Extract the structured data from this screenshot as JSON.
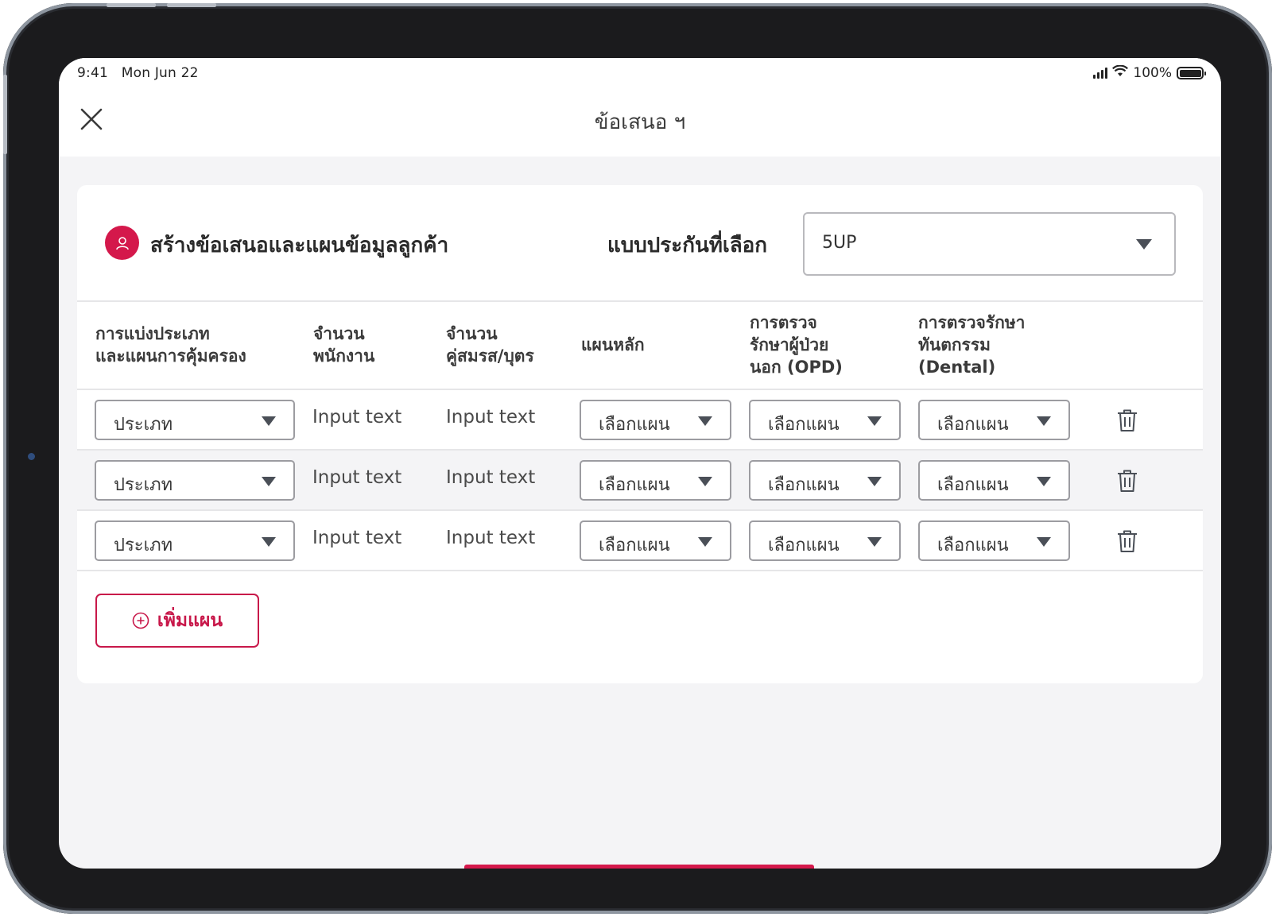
{
  "status_bar": {
    "time": "9:41",
    "date": "Mon Jun 22",
    "battery": "100%"
  },
  "nav": {
    "title": "ข้อเสนอ ฯ"
  },
  "card": {
    "title": "สร้างข้อเสนอและแผนข้อมูลลูกค้า",
    "insurance_label": "แบบประกันที่เลือก",
    "insurance_value": "5UP"
  },
  "table": {
    "headers": {
      "category": [
        "การแบ่งประเภท",
        "และแผนการคุ้มครอง"
      ],
      "employees": [
        "จำนวน",
        "พนักงาน"
      ],
      "spouse_children": [
        "จำนวน",
        "คู่สมรส/บุตร"
      ],
      "main_plan": [
        "แผนหลัก"
      ],
      "opd": [
        "การตรวจ",
        "รักษาผู้ป่วย",
        "นอก (OPD)"
      ],
      "dental": [
        "การตรวจรักษา",
        "ทันตกรรม",
        "(Dental)"
      ]
    },
    "rows": [
      {
        "category": "ประเภท",
        "employees": "Input text",
        "spouse_children": "Input text",
        "main_plan": "เลือกแผน",
        "opd": "เลือกแผน",
        "dental": "เลือกแผน"
      },
      {
        "category": "ประเภท",
        "employees": "Input text",
        "spouse_children": "Input text",
        "main_plan": "เลือกแผน",
        "opd": "เลือกแผน",
        "dental": "เลือกแผน"
      },
      {
        "category": "ประเภท",
        "employees": "Input text",
        "spouse_children": "Input text",
        "main_plan": "เลือกแผน",
        "opd": "เลือกแผน",
        "dental": "เลือกแผน"
      }
    ]
  },
  "actions": {
    "add_plan": "เพิ่มแผน"
  },
  "icons": [
    "close-icon",
    "user-icon",
    "caret-down-icon",
    "trash-icon",
    "plus-circle-icon",
    "signal-icon",
    "wifi-icon",
    "battery-icon"
  ],
  "colors": {
    "accent": "#d4184b",
    "border": "#9c9ca1",
    "background": "#f4f4f6"
  }
}
